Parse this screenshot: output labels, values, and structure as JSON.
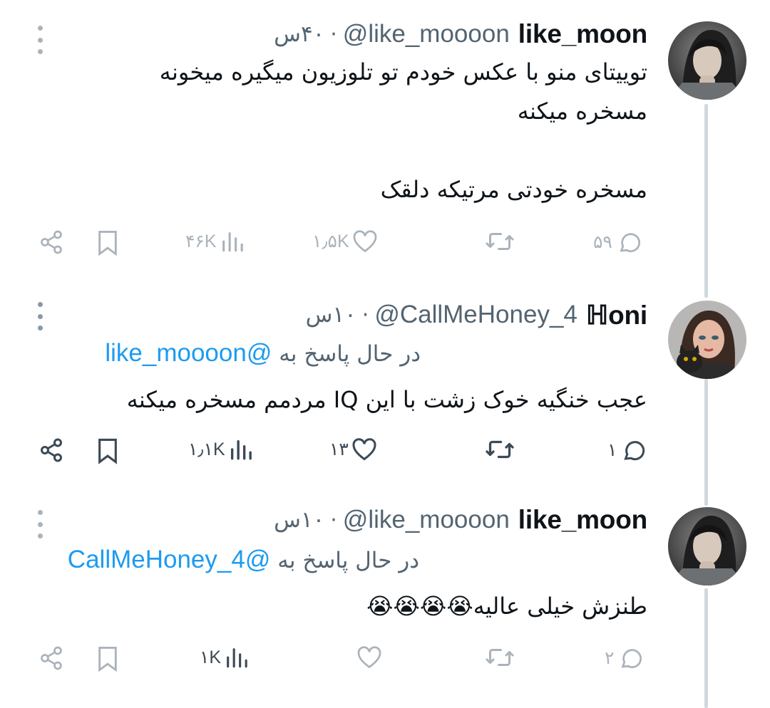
{
  "tweets": [
    {
      "display_name": "like_moon",
      "handle": "@like_moooon",
      "time": "۴۰س",
      "lines": [
        "توییتای منو با عکس خودم تو تلوزیون میگیره میخونه",
        "مسخره میکنه",
        "",
        "مسخره خودتی مرتیکه دلقک"
      ],
      "replies": "۵۹",
      "retweets": "",
      "likes": "۱٫۵K",
      "views": "۴۶K",
      "avatar_icon": "avatar-photo-woman-hand-on-face"
    },
    {
      "display_name": "ℍoni",
      "handle": "@CallMeHoney_4",
      "time": "۱۰س",
      "reply_prefix": "در حال پاسخ به",
      "reply_to": "@like_moooon",
      "lines": [
        "عجب خنگیه خوک زشت با این IQ مردمم مسخره میکنه"
      ],
      "replies": "۱",
      "retweets": "",
      "likes": "۱۳",
      "views": "۱٫۱K",
      "avatar_icon": "avatar-illustration-woman-with-cat"
    },
    {
      "display_name": "like_moon",
      "handle": "@like_moooon",
      "time": "۱۰س",
      "reply_prefix": "در حال پاسخ به",
      "reply_to": "@CallMeHoney_4",
      "lines": [
        "طنزش خیلی عالیه😭😭😭😭"
      ],
      "replies": "۲",
      "retweets": "",
      "likes": "",
      "views": "۱K",
      "avatar_icon": "avatar-photo-woman-hand-on-face"
    }
  ],
  "colors": {
    "link": "#1d9bf0",
    "text": "#0f1419",
    "secondary": "#536471",
    "thread_line": "#cfd9de"
  },
  "icons": [
    "share-icon",
    "bookmark-icon",
    "views-icon",
    "like-icon",
    "retweet-icon",
    "reply-icon",
    "more-icon"
  ]
}
